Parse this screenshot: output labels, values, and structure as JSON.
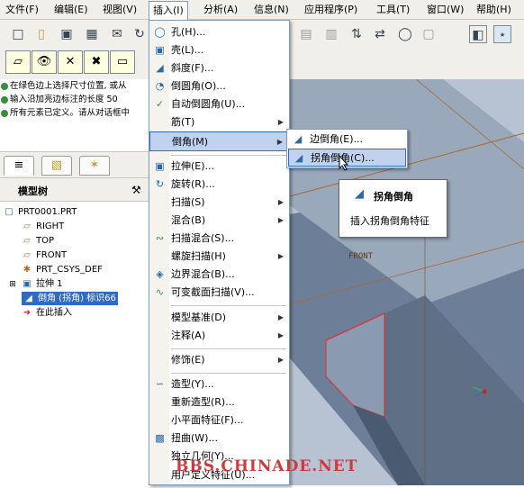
{
  "menubar": {
    "items": [
      {
        "label": "文件(F)"
      },
      {
        "label": "编辑(E)"
      },
      {
        "label": "视图(V)"
      },
      {
        "label": "插入(I)"
      },
      {
        "label": "分析(A)"
      },
      {
        "label": "信息(N)"
      },
      {
        "label": "应用程序(P)"
      },
      {
        "label": "工具(T)"
      },
      {
        "label": "窗口(W)"
      },
      {
        "label": "帮助(H)"
      }
    ],
    "active_index": 3
  },
  "messages": [
    "在绿色边上选择尺寸位置, 或从",
    "输入沿加亮边标注的长度    50",
    "所有元素已定义。请从对话框中"
  ],
  "model_tree": {
    "title": "模型树",
    "nodes": [
      {
        "label": "PRT0001.PRT",
        "icon": "part-icon"
      },
      {
        "label": "RIGHT",
        "icon": "datum-plane-icon"
      },
      {
        "label": "TOP",
        "icon": "datum-plane-icon"
      },
      {
        "label": "FRONT",
        "icon": "datum-plane-icon"
      },
      {
        "label": "PRT_CSYS_DEF",
        "icon": "csys-icon"
      },
      {
        "label": "拉伸 1",
        "icon": "extrude-icon"
      },
      {
        "label": "倒角 (拐角) 标识66",
        "icon": "chamfer-icon"
      },
      {
        "label": "在此插入",
        "icon": "insert-here-icon"
      }
    ]
  },
  "insert_menu": {
    "items": [
      {
        "label": "孔(H)...",
        "icon": "hole-icon",
        "submenu": false
      },
      {
        "label": "壳(L)...",
        "icon": "shell-icon",
        "submenu": false
      },
      {
        "label": "斜度(F)...",
        "icon": "draft-icon",
        "submenu": false
      },
      {
        "label": "倒圆角(O)...",
        "icon": "round-icon",
        "submenu": false
      },
      {
        "label": "自动倒圆角(U)...",
        "icon": "auto-round-icon",
        "submenu": false
      },
      {
        "label": "筋(T)",
        "icon": "",
        "submenu": true
      },
      {
        "label": "倒角(M)",
        "icon": "",
        "submenu": true
      },
      {
        "label": "拉伸(E)...",
        "icon": "extrude-icon",
        "submenu": false
      },
      {
        "label": "旋转(R)...",
        "icon": "revolve-icon",
        "submenu": false
      },
      {
        "label": "扫描(S)",
        "icon": "",
        "submenu": true
      },
      {
        "label": "混合(B)",
        "icon": "",
        "submenu": true
      },
      {
        "label": "扫描混合(S)...",
        "icon": "swept-blend-icon",
        "submenu": false
      },
      {
        "label": "螺旋扫描(H)",
        "icon": "",
        "submenu": true
      },
      {
        "label": "边界混合(B)...",
        "icon": "boundary-blend-icon",
        "submenu": false
      },
      {
        "label": "可变截面扫描(V)...",
        "icon": "variable-sweep-icon",
        "submenu": false
      },
      {
        "label": "模型基准(D)",
        "icon": "",
        "submenu": true
      },
      {
        "label": "注释(A)",
        "icon": "",
        "submenu": true
      },
      {
        "label": "修饰(E)",
        "icon": "",
        "submenu": true
      },
      {
        "label": "造型(Y)...",
        "icon": "style-icon",
        "submenu": false
      },
      {
        "label": "重新造型(R)...",
        "icon": "",
        "submenu": false
      },
      {
        "label": "小平面特征(F)...",
        "icon": "",
        "submenu": false
      },
      {
        "label": "扭曲(W)...",
        "icon": "warp-icon",
        "submenu": false
      },
      {
        "label": "独立几何(Y)...",
        "icon": "",
        "submenu": false
      },
      {
        "label": "用户定义特征(U)...",
        "icon": "",
        "submenu": false
      }
    ],
    "highlighted_index": 6
  },
  "chamfer_submenu": {
    "items": [
      {
        "label": "边倒角(E)...",
        "icon": "edge-chamfer-icon"
      },
      {
        "label": "拐角倒角(C)...",
        "icon": "corner-chamfer-icon"
      }
    ],
    "highlighted_index": 1
  },
  "tooltip": {
    "title": "拐角倒角",
    "description": "插入拐角倒角特征"
  },
  "graphics": {
    "datum_label": "FRONT"
  },
  "watermark": "BBS.CHINADE.NET",
  "colors": {
    "selection": "#316ac5",
    "menu_highlight": "#c1d2ee",
    "watermark": "#d23a3a",
    "chamfer_edge": "#e03030"
  }
}
